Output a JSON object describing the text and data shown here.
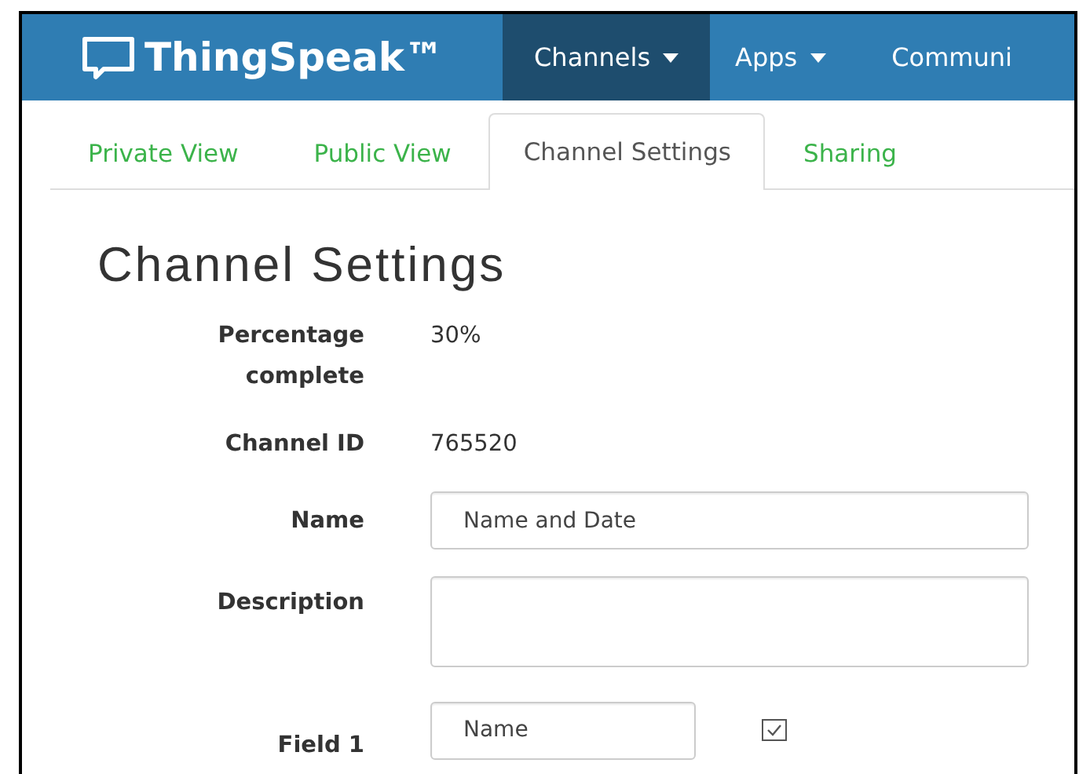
{
  "navbar": {
    "brand": "ThingSpeak™",
    "items": [
      {
        "label": "Channels",
        "selected": true,
        "dropdown": true
      },
      {
        "label": "Apps",
        "selected": false,
        "dropdown": true
      },
      {
        "label": "Communi",
        "selected": false,
        "dropdown": false
      }
    ]
  },
  "tabs": [
    {
      "label": "Private View",
      "selected": false
    },
    {
      "label": "Public View",
      "selected": false
    },
    {
      "label": "Channel Settings",
      "selected": true
    },
    {
      "label": "Sharing",
      "selected": false
    }
  ],
  "heading": "Channel Settings",
  "rows": [
    {
      "kind": "text",
      "label": "Percentage complete",
      "value": "30%"
    },
    {
      "kind": "text",
      "label": "Channel ID",
      "value": "765520"
    },
    {
      "kind": "input",
      "label": "Name",
      "value": "Name and Date"
    },
    {
      "kind": "textarea",
      "label": "Description"
    },
    {
      "kind": "field",
      "label": "Field 1",
      "value": "Name",
      "checked": true
    }
  ]
}
